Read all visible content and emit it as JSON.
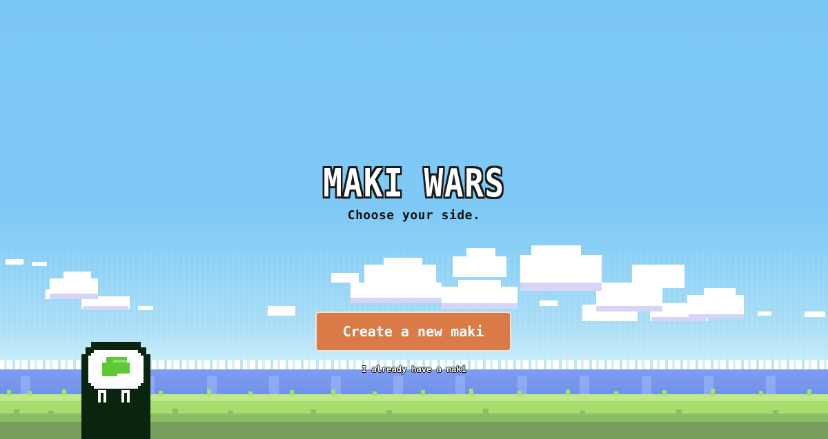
{
  "game": {
    "title": "MAKI WARS",
    "tagline": "Choose your side."
  },
  "actions": {
    "create_label": "Create a new maki",
    "existing_label": "I already have a maki"
  },
  "colors": {
    "sky": "#7cc8f6",
    "button": "#d97a47",
    "sea": "#6a8fe8",
    "grass_light": "#a7dc6e",
    "grass_dark": "#78a45a",
    "maki_nori": "#0b2410",
    "maki_filling": "#5ec836"
  },
  "mascot": {
    "icon": "maki-sushi-character-icon"
  }
}
